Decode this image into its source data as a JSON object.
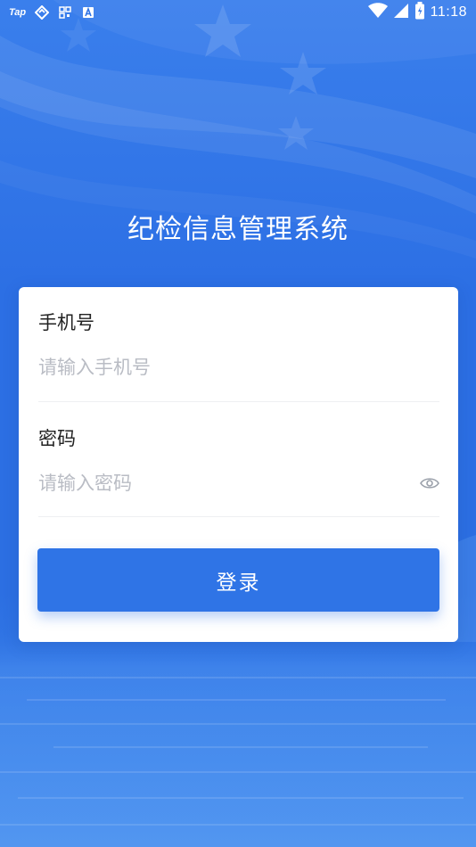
{
  "status_bar": {
    "time": "11:18",
    "left_label": "Tap",
    "left_icons": [
      "tap-app-icon",
      "sync-icon",
      "qr-scan-icon",
      "font-a-icon"
    ],
    "right_icons": [
      "wifi-icon",
      "signal-icon",
      "battery-icon"
    ]
  },
  "app": {
    "title": "纪检信息管理系统"
  },
  "login_form": {
    "phone": {
      "label": "手机号",
      "value": "",
      "placeholder": "请输入手机号"
    },
    "password": {
      "label": "密码",
      "value": "",
      "placeholder": "请输入密码",
      "toggle_icon": "eye-icon"
    },
    "submit_label": "登录"
  },
  "colors": {
    "background": "#2d71e5",
    "primary_button": "#2f74e6",
    "card": "#ffffff",
    "placeholder": "#b9bcc4",
    "label": "#222222"
  }
}
